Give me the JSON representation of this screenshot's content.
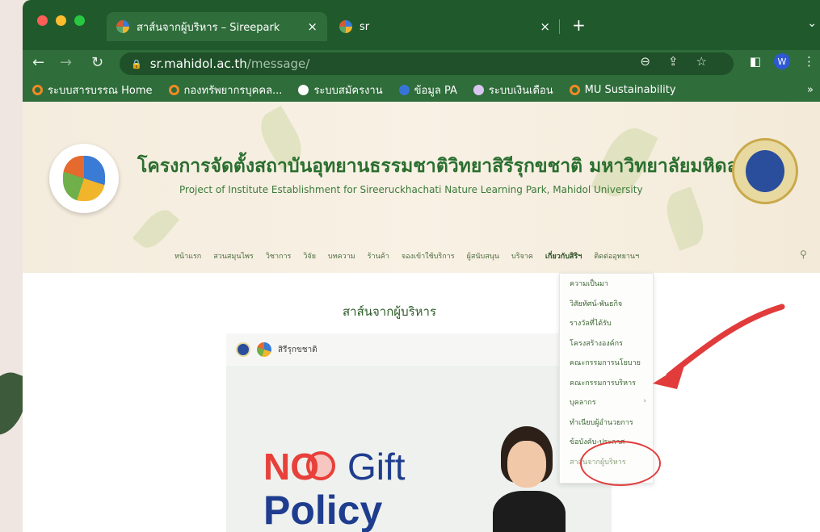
{
  "browser": {
    "tabs": [
      {
        "title": "สาส์นจากผู้บริหาร – Sireepark",
        "close": "×",
        "active": true
      },
      {
        "title": "sr",
        "close": "×",
        "active": false
      }
    ],
    "new_tab": "+",
    "tab_menu": "⌄",
    "url_host": "sr.mahidol.ac.th",
    "url_path": "/message/",
    "avatar_initial": "W",
    "bookmarks": [
      {
        "label": "ระบบสารบรรณ Home",
        "icon": "orange-ring-icon"
      },
      {
        "label": "กองทรัพยากรบุคคล...",
        "icon": "orange-ring-icon"
      },
      {
        "label": "ระบบสมัครงาน",
        "icon": "globe-icon"
      },
      {
        "label": "ข้อมูล PA",
        "icon": "blue-circle-icon"
      },
      {
        "label": "ระบบเงินเดือน",
        "icon": "purple-circle-icon"
      },
      {
        "label": "MU Sustainability",
        "icon": "orange-ring-icon"
      }
    ],
    "bookmarks_more": "»"
  },
  "site": {
    "title_th": "โครงการจัดตั้งสถาบันอุทยานธรรมชาติวิทยาสิรีรุกขชาติ มหาวิทยาลัยมหิดล",
    "title_en": "Project of Institute Establishment for Sireeruckhachati Nature Learning Park, Mahidol University",
    "menu": [
      "หน้าแรก",
      "สวนสมุนไพร",
      "วิชาการ",
      "วิจัย",
      "บทความ",
      "ร้านค้า",
      "จองเข้าใช้บริการ",
      "ผู้สนับสนุน",
      "บริจาค",
      "เกี่ยวกับสิริฯ",
      "ติดต่ออุทยานฯ"
    ],
    "active_menu": "เกี่ยวกับสิริฯ",
    "dropdown": [
      "ความเป็นมา",
      "วิสัยทัศน์-พันธกิจ",
      "รางวัลที่ได้รับ",
      "โครงสร้างองค์กร",
      "คณะกรรมการนโยบาย",
      "คณะกรรมการบริหาร",
      "บุคลากร",
      "ทำเนียบผู้อำนวยการ",
      "ข้อบังคับ-ประกาศ",
      "สาส์นจากผู้บริหาร"
    ],
    "page_title": "สาส์นจากผู้บริหาร",
    "poster": {
      "brand": "สิรีรุกขชาติ",
      "no": "NO",
      "gift": "Gift",
      "policy": "Policy"
    }
  },
  "colors": {
    "chrome_green": "#205a2c",
    "accent_red": "#e23b3b",
    "site_green": "#2a6e2f"
  }
}
